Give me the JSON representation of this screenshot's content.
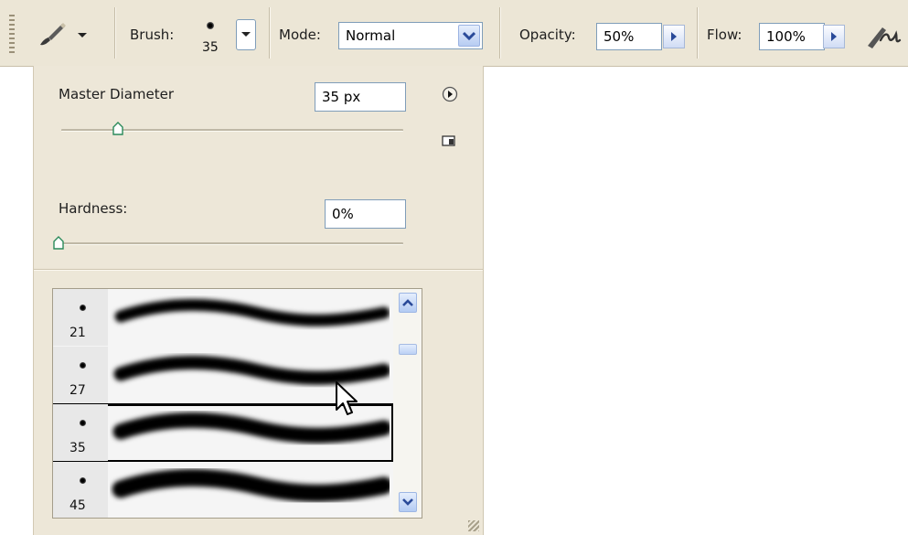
{
  "toolbar": {
    "brush_label": "Brush:",
    "brush_size": "35",
    "mode_label": "Mode:",
    "mode_value": "Normal",
    "opacity_label": "Opacity:",
    "opacity_value": "50%",
    "flow_label": "Flow:",
    "flow_value": "100%"
  },
  "panel": {
    "master_diameter_label": "Master Diameter",
    "master_diameter_value": "35 px",
    "master_diameter_slider": 0.16,
    "hardness_label": "Hardness:",
    "hardness_value": "0%",
    "hardness_slider": 0.0
  },
  "brushes": {
    "items": [
      {
        "size": "21"
      },
      {
        "size": "27"
      },
      {
        "size": "35",
        "selected": true
      },
      {
        "size": "45"
      }
    ]
  },
  "colors": {
    "toolbar_bg": "#ece6d6",
    "panel_bg": "#ede7d8",
    "xp_blue": "#2a4a99"
  },
  "icons": [
    "brush-tool-icon",
    "brush-preset-dot-icon",
    "dropdown-arrow-icon",
    "play-menu-icon",
    "new-preset-icon",
    "airbrush-icon",
    "scroll-up-icon",
    "scroll-down-icon",
    "mouse-cursor-icon"
  ]
}
